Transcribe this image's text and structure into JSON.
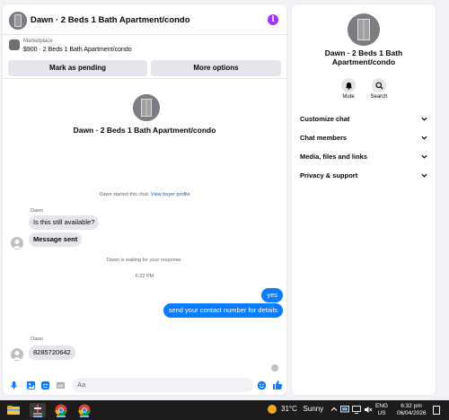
{
  "chat": {
    "header_title": "Dawn · 2 Beds 1 Bath Apartment/condo",
    "listing": {
      "source": "Marketplace",
      "title": "$900 · 2 Beds 1 Bath Apartment/condo",
      "pending_button": "Mark as pending",
      "more_button": "More options"
    },
    "convo_title": "Dawn · 2 Beds 1 Bath Apartment/condo",
    "started_text": "Dawn started this chat.",
    "view_profile_link": "View buyer profile",
    "messages_first": {
      "sender": "Dawn",
      "bubble_1": "Is this still available?",
      "bubble_2": "Message sent"
    },
    "waiting_text": "Dawn is waiting for your response.",
    "time_text": "6:22 PM",
    "outgoing_1": "yes",
    "outgoing_2": "send your contact number for details",
    "messages_second": {
      "sender": "Dawn",
      "bubble": "8285720642"
    },
    "composer_placeholder": "Aa",
    "accent_color": "#0a7cff"
  },
  "info_panel": {
    "title": "Dawn · 2 Beds 1 Bath Apartment/condo",
    "mute_label": "Mute",
    "search_label": "Search",
    "menu": [
      {
        "label": "Customize chat"
      },
      {
        "label": "Chat members"
      },
      {
        "label": "Media, files and links"
      },
      {
        "label": "Privacy & support"
      }
    ]
  },
  "taskbar": {
    "temperature": "31°C",
    "weather": "Sunny",
    "lang_1": "ENG",
    "lang_2": "US",
    "time": "6:32 pm",
    "date": "06/04/2026"
  }
}
